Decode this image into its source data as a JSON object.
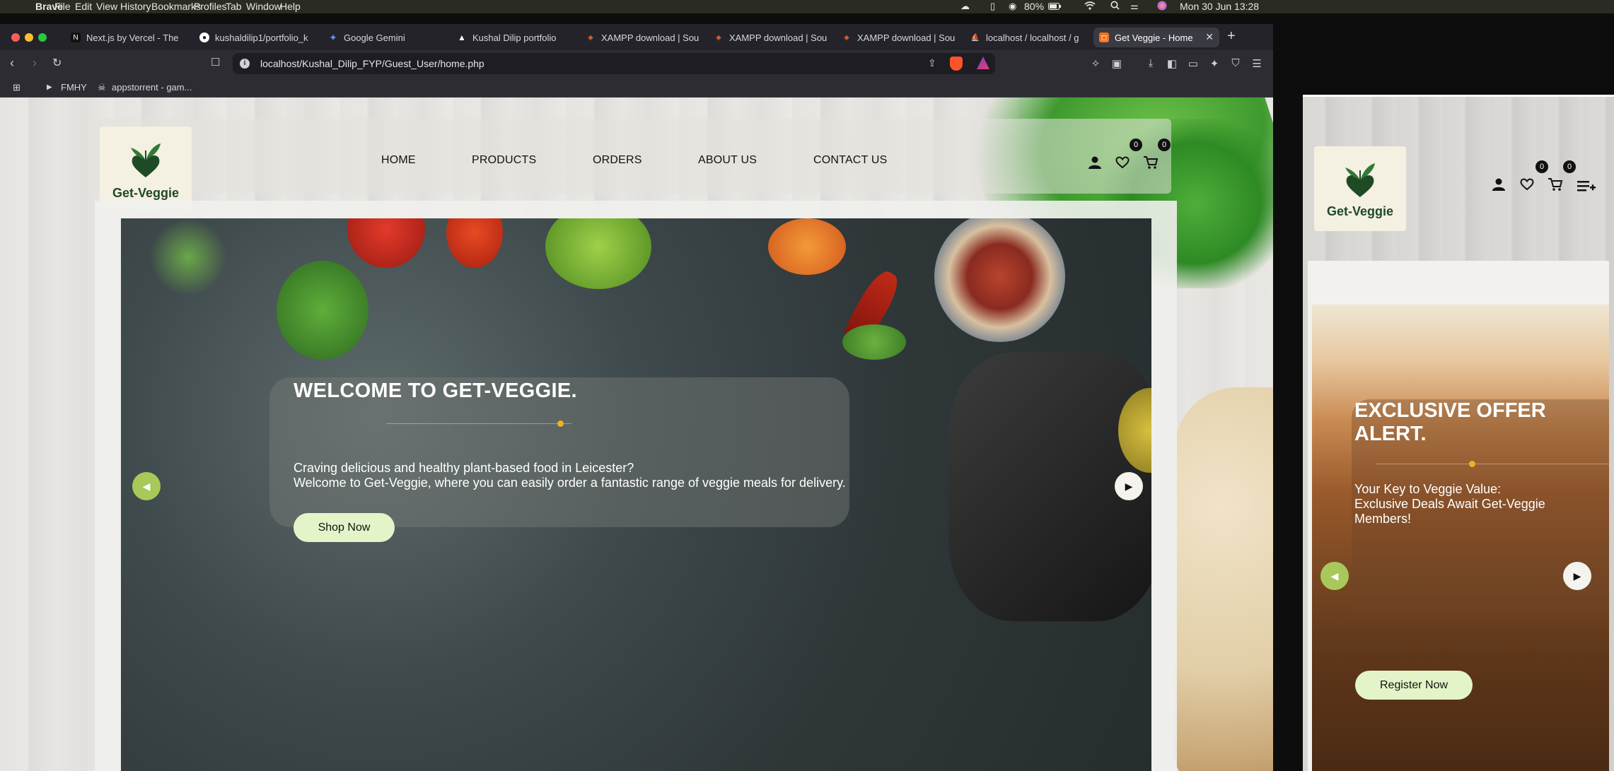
{
  "menubar": {
    "app_name": "Brave",
    "items": [
      "File",
      "Edit",
      "View",
      "History",
      "Bookmarks",
      "Profiles",
      "Tab",
      "Window",
      "Help"
    ],
    "battery": "80%",
    "datetime": "Mon 30 Jun  13:28"
  },
  "browser": {
    "tabs": [
      {
        "title": "Next.js by Vercel - The",
        "icon": "nextjs-icon"
      },
      {
        "title": "kushaldilip1/portfolio_k",
        "icon": "github-icon"
      },
      {
        "title": "Google Gemini",
        "icon": "gemini-icon"
      },
      {
        "title": "Kushal Dilip portfolio",
        "icon": "vercel-icon"
      },
      {
        "title": "XAMPP download | Sou",
        "icon": "sourceforge-icon"
      },
      {
        "title": "XAMPP download | Sou",
        "icon": "sourceforge-icon"
      },
      {
        "title": "XAMPP download | Sou",
        "icon": "sourceforge-icon"
      },
      {
        "title": "localhost / localhost / g",
        "icon": "phpmyadmin-icon"
      },
      {
        "title": "Get Veggie - Home",
        "icon": "site-icon",
        "active": true
      }
    ],
    "url": "localhost/Kushal_Dilip_FYP/Guest_User/home.php",
    "bookmarks": [
      "FMHY",
      "appstorrent - gam..."
    ]
  },
  "site": {
    "brand": "Get-Veggie",
    "nav": [
      "HOME",
      "PRODUCTS",
      "ORDERS",
      "ABOUT US",
      "CONTACT US"
    ],
    "wishlist_count": "0",
    "cart_count": "0",
    "hero": {
      "title": "WELCOME TO GET-VEGGIE.",
      "line1": "Craving delicious and healthy plant-based food in Leicester?",
      "line2": "Welcome to Get-Veggie, where you can easily order a fantastic range of veggie meals for delivery.",
      "button": "Shop Now"
    }
  },
  "mobile": {
    "brand": "Get-Veggie",
    "wishlist_count": "0",
    "cart_count": "0",
    "hero": {
      "title_line1": "EXCLUSIVE OFFER",
      "title_line2": "ALERT.",
      "line1": "Your Key to Veggie Value:",
      "line2": "Exclusive Deals Await Get-Veggie",
      "line3": "Members!",
      "button": "Register Now"
    }
  },
  "colors": {
    "accent_green": "#a8c95a",
    "button_bg": "#e3f5c8",
    "dot_orange": "#f0b020",
    "brand_green": "#1f4a26"
  }
}
